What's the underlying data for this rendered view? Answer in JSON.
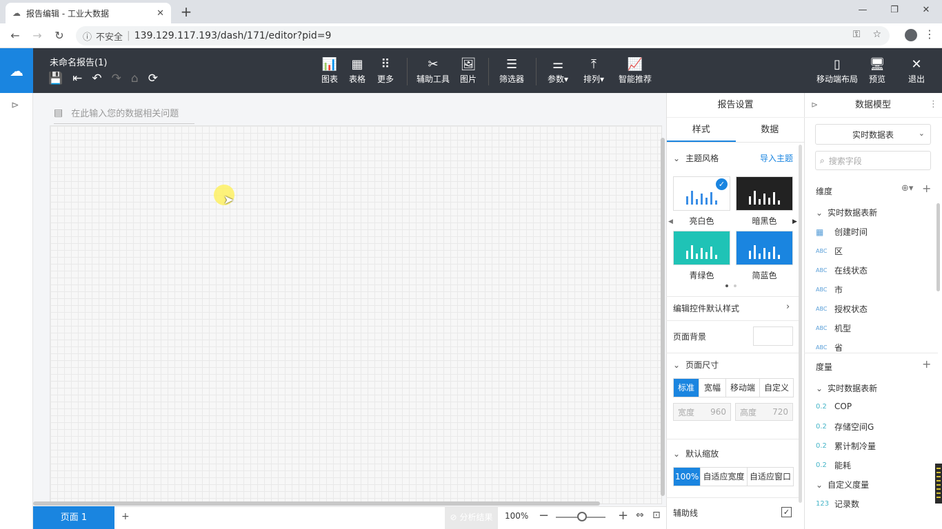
{
  "browser": {
    "tab_title": "报告编辑 - 工业大数据",
    "tab_close": "✕",
    "new_tab": "+",
    "security_label": "不安全",
    "url": "139.129.117.193/dash/171/editor?pid=9"
  },
  "toolbar": {
    "report_title": "未命名报告(1)",
    "items": {
      "chart": "图表",
      "table": "表格",
      "more": "更多",
      "assist": "辅助工具",
      "image": "图片",
      "filter": "筛选器",
      "params": "参数",
      "arrange": "排列",
      "smart": "智能推荐",
      "mobile_layout": "移动端布局",
      "preview": "预览",
      "exit": "退出"
    }
  },
  "canvas": {
    "nlq_placeholder": "在此输入您的数据相关问题"
  },
  "bottom": {
    "page_tab": "页面 1",
    "add_page": "+",
    "analysis": "分析结果",
    "zoom": "100%"
  },
  "settings": {
    "title": "报告设置",
    "tab_style": "样式",
    "tab_data": "数据",
    "theme_section": "主题风格",
    "import_theme": "导入主题",
    "themes": [
      {
        "label": "亮白色",
        "bg": "#ffffff",
        "bar": "#3a8ee6"
      },
      {
        "label": "暗黑色",
        "bg": "#222222",
        "bar": "#ffffff"
      },
      {
        "label": "青绿色",
        "bg": "#1fc3b6",
        "bar": "#ffffff"
      },
      {
        "label": "简蓝色",
        "bg": "#1a85e0",
        "bar": "#ffffff"
      }
    ],
    "edit_default_style": "编辑控件默认样式",
    "page_bg": "页面背景",
    "page_size": "页面尺寸",
    "size_options": [
      "标准",
      "宽幅",
      "移动端",
      "自定义"
    ],
    "width_label": "宽度",
    "width_value": "960",
    "height_label": "高度",
    "height_value": "720",
    "default_zoom": "默认缩放",
    "zoom_options": [
      "100%",
      "自适应宽度",
      "自适应窗口"
    ],
    "aux_lines": "辅助线"
  },
  "model": {
    "title": "数据模型",
    "table": "实时数据表",
    "search_placeholder": "搜索字段",
    "dim_header": "维度",
    "dim_group": "实时数据表新",
    "dims": [
      {
        "type": "date",
        "name": "创建时间"
      },
      {
        "type": "ABC",
        "name": "区"
      },
      {
        "type": "ABC",
        "name": "在线状态"
      },
      {
        "type": "ABC",
        "name": "市"
      },
      {
        "type": "ABC",
        "name": "授权状态"
      },
      {
        "type": "ABC",
        "name": "机型"
      },
      {
        "type": "ABC",
        "name": "省"
      }
    ],
    "measure_header": "度量",
    "measure_group": "实时数据表新",
    "measures": [
      {
        "type": "0.2",
        "name": "COP"
      },
      {
        "type": "0.2",
        "name": "存储空间G"
      },
      {
        "type": "0.2",
        "name": "累计制冷量"
      },
      {
        "type": "0.2",
        "name": "能耗"
      }
    ],
    "custom_group": "自定义度量",
    "custom_measures": [
      {
        "type": "123",
        "name": "记录数"
      }
    ]
  }
}
